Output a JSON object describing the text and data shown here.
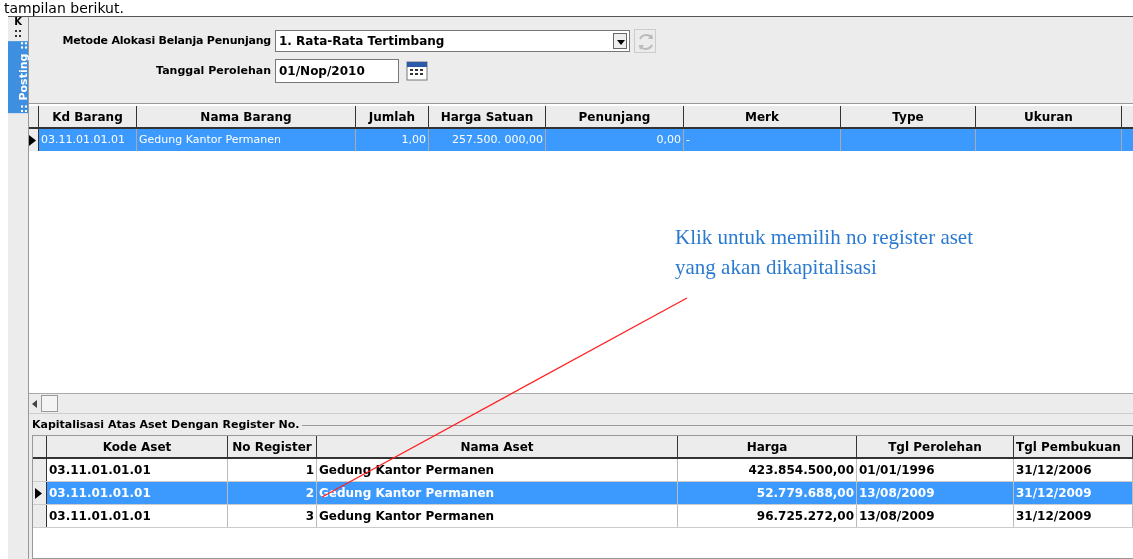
{
  "doc_text": "tampilan berikut.",
  "side_tab": {
    "label": ":: Posting ::",
    "mark": "K"
  },
  "form": {
    "method_label": "Metode Alokasi Belanja Penunjang",
    "method_value": "1. Rata-Rata Tertimbang",
    "date_label": "Tanggal Perolehan",
    "date_value": "01/Nop/2010"
  },
  "items_table": {
    "columns": [
      "Kd Barang",
      "Nama Barang",
      "Jumlah",
      "Harga Satuan",
      "Penunjang",
      "Merk",
      "Type",
      "Ukuran"
    ],
    "rows": [
      {
        "selected": true,
        "cells": [
          "03.11.01.01.01",
          "Gedung Kantor Permanen",
          "1,00",
          "257.500. 000,00",
          "0,00",
          "-",
          "",
          ""
        ]
      }
    ]
  },
  "annotation": {
    "text": "Klik untuk memilih no register aset yang akan dikapitalisasi"
  },
  "register_group": {
    "title": "Kapitalisasi Atas Aset Dengan Register No.",
    "columns": [
      "Kode Aset",
      "No Register",
      "Nama Aset",
      "Harga",
      "Tgl Perolehan",
      "Tgl Pembukuan"
    ],
    "rows": [
      {
        "selected": false,
        "cells": [
          "03.11.01.01.01",
          "1",
          "Gedung Kantor Permanen",
          "423.854.500,00",
          "01/01/1996",
          "31/12/2006"
        ]
      },
      {
        "selected": true,
        "cells": [
          "03.11.01.01.01",
          "2",
          "Gedung Kantor Permanen",
          "52.779.688,00",
          "13/08/2009",
          "31/12/2009"
        ]
      },
      {
        "selected": false,
        "cells": [
          "03.11.01.01.01",
          "3",
          "Gedung Kantor Permanen",
          "96.725.272,00",
          "13/08/2009",
          "31/12/2009"
        ]
      }
    ]
  }
}
